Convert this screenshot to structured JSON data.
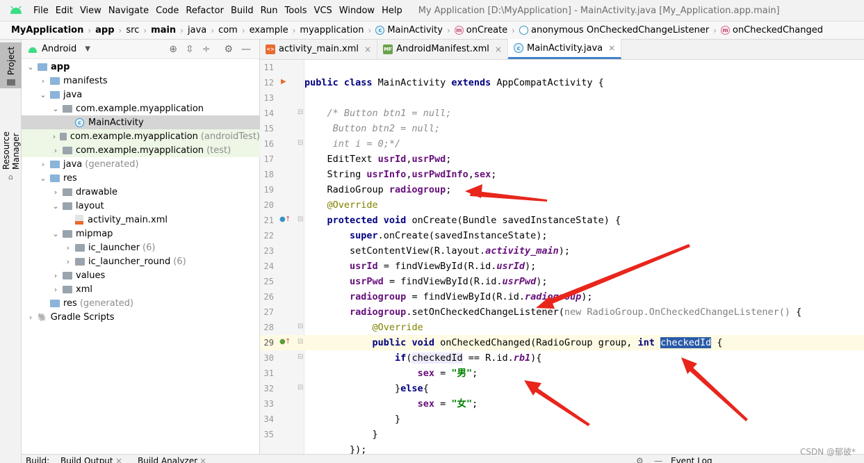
{
  "menubar": {
    "items": [
      "File",
      "Edit",
      "View",
      "Navigate",
      "Code",
      "Refactor",
      "Build",
      "Run",
      "Tools",
      "VCS",
      "Window",
      "Help"
    ],
    "window_title": "My Application [D:\\MyApplication] - MainActivity.java [My_Application.app.main]"
  },
  "breadcrumb": {
    "items": [
      {
        "label": "MyApplication",
        "bold": true,
        "icon": ""
      },
      {
        "label": "app",
        "bold": true,
        "icon": ""
      },
      {
        "label": "src",
        "bold": false,
        "icon": ""
      },
      {
        "label": "main",
        "bold": true,
        "icon": ""
      },
      {
        "label": "java",
        "bold": false,
        "icon": ""
      },
      {
        "label": "com",
        "bold": false,
        "icon": ""
      },
      {
        "label": "example",
        "bold": false,
        "icon": ""
      },
      {
        "label": "myapplication",
        "bold": false,
        "icon": ""
      },
      {
        "label": "MainActivity",
        "bold": false,
        "icon": "class-icon"
      },
      {
        "label": "onCreate",
        "bold": false,
        "icon": "method-icon"
      },
      {
        "label": "anonymous OnCheckedChangeListener",
        "bold": false,
        "icon": "anonymous-class-icon"
      },
      {
        "label": "onCheckedChanged",
        "bold": false,
        "icon": "method-icon"
      }
    ]
  },
  "left_stripe": {
    "project_label": "Project",
    "resource_label": "Resource Manager"
  },
  "project_panel": {
    "view_mode": "Android",
    "tree": [
      {
        "label": "app",
        "depth": 0,
        "expanded": true,
        "icon": "folder-icon",
        "bold": true,
        "suffix": "",
        "selected": false,
        "test": false
      },
      {
        "label": "manifests",
        "depth": 1,
        "expanded": false,
        "icon": "folder-icon",
        "bold": false,
        "suffix": "",
        "selected": false,
        "test": false
      },
      {
        "label": "java",
        "depth": 1,
        "expanded": true,
        "icon": "folder-icon",
        "bold": false,
        "suffix": "",
        "selected": false,
        "test": false
      },
      {
        "label": "com.example.myapplication",
        "depth": 2,
        "expanded": true,
        "icon": "package-icon",
        "bold": false,
        "suffix": "",
        "selected": false,
        "test": false
      },
      {
        "label": "MainActivity",
        "depth": 3,
        "expanded": null,
        "icon": "class-icon",
        "bold": false,
        "suffix": "",
        "selected": true,
        "test": false
      },
      {
        "label": "com.example.myapplication",
        "depth": 2,
        "expanded": false,
        "icon": "package-icon",
        "bold": false,
        "suffix": "(androidTest)",
        "selected": false,
        "test": true
      },
      {
        "label": "com.example.myapplication",
        "depth": 2,
        "expanded": false,
        "icon": "package-icon",
        "bold": false,
        "suffix": "(test)",
        "selected": false,
        "test": true
      },
      {
        "label": "java",
        "depth": 1,
        "expanded": false,
        "icon": "folder-icon",
        "bold": false,
        "suffix": "(generated)",
        "selected": false,
        "test": false
      },
      {
        "label": "res",
        "depth": 1,
        "expanded": true,
        "icon": "folder-icon",
        "bold": false,
        "suffix": "",
        "selected": false,
        "test": false
      },
      {
        "label": "drawable",
        "depth": 2,
        "expanded": false,
        "icon": "package-icon",
        "bold": false,
        "suffix": "",
        "selected": false,
        "test": false
      },
      {
        "label": "layout",
        "depth": 2,
        "expanded": true,
        "icon": "package-icon",
        "bold": false,
        "suffix": "",
        "selected": false,
        "test": false
      },
      {
        "label": "activity_main.xml",
        "depth": 3,
        "expanded": null,
        "icon": "xml-file-icon",
        "bold": false,
        "suffix": "",
        "selected": false,
        "test": false
      },
      {
        "label": "mipmap",
        "depth": 2,
        "expanded": true,
        "icon": "package-icon",
        "bold": false,
        "suffix": "",
        "selected": false,
        "test": false
      },
      {
        "label": "ic_launcher",
        "depth": 3,
        "expanded": false,
        "icon": "package-icon",
        "bold": false,
        "suffix": "(6)",
        "selected": false,
        "test": false
      },
      {
        "label": "ic_launcher_round",
        "depth": 3,
        "expanded": false,
        "icon": "package-icon",
        "bold": false,
        "suffix": "(6)",
        "selected": false,
        "test": false
      },
      {
        "label": "values",
        "depth": 2,
        "expanded": false,
        "icon": "package-icon",
        "bold": false,
        "suffix": "",
        "selected": false,
        "test": false
      },
      {
        "label": "xml",
        "depth": 2,
        "expanded": false,
        "icon": "package-icon",
        "bold": false,
        "suffix": "",
        "selected": false,
        "test": false
      },
      {
        "label": "res",
        "depth": 1,
        "expanded": null,
        "icon": "folder-icon",
        "bold": false,
        "suffix": "(generated)",
        "selected": false,
        "test": false
      },
      {
        "label": "Gradle Scripts",
        "depth": 0,
        "expanded": false,
        "icon": "gradle-icon",
        "bold": false,
        "suffix": "",
        "selected": false,
        "test": false
      }
    ]
  },
  "editor": {
    "tabs": [
      {
        "label": "activity_main.xml",
        "icon": "xml-file-icon",
        "active": false
      },
      {
        "label": "AndroidManifest.xml",
        "icon": "manifest-file-icon",
        "active": false
      },
      {
        "label": "MainActivity.java",
        "icon": "class-icon",
        "active": true
      }
    ],
    "current_line": 29,
    "lines": [
      {
        "n": "11",
        "tokens": []
      },
      {
        "n": "12",
        "tokens": [
          [
            "kw",
            "public class "
          ],
          [
            "",
            "MainActivity "
          ],
          [
            "kw",
            "extends "
          ],
          [
            "",
            "AppCompatActivity {"
          ]
        ]
      },
      {
        "n": "13",
        "tokens": []
      },
      {
        "n": "14",
        "tokens": [
          [
            "",
            "    "
          ],
          [
            "cmt",
            "/* Button btn1 = null;"
          ]
        ]
      },
      {
        "n": "15",
        "tokens": [
          [
            "",
            "    "
          ],
          [
            "cmt",
            " Button btn2 = null;"
          ]
        ]
      },
      {
        "n": "16",
        "tokens": [
          [
            "",
            "    "
          ],
          [
            "cmt",
            " int i = 0;*/"
          ]
        ]
      },
      {
        "n": "17",
        "tokens": [
          [
            "",
            "    EditText "
          ],
          [
            "fld",
            "usrId"
          ],
          [
            "",
            ","
          ],
          [
            "fld",
            "usrPwd"
          ],
          [
            "",
            ";"
          ]
        ]
      },
      {
        "n": "18",
        "tokens": [
          [
            "",
            "    String "
          ],
          [
            "fld",
            "usrInfo"
          ],
          [
            "",
            ","
          ],
          [
            "fld",
            "usrPwdInfo"
          ],
          [
            "",
            ","
          ],
          [
            "fld",
            "sex"
          ],
          [
            "",
            ";"
          ]
        ]
      },
      {
        "n": "19",
        "tokens": [
          [
            "",
            "    RadioGroup "
          ],
          [
            "fld",
            "radiogroup"
          ],
          [
            "",
            ";"
          ]
        ]
      },
      {
        "n": "20",
        "tokens": [
          [
            "",
            "    "
          ],
          [
            "ann",
            "@Override"
          ]
        ]
      },
      {
        "n": "21",
        "tokens": [
          [
            "",
            "    "
          ],
          [
            "kw",
            "protected void "
          ],
          [
            "",
            "onCreate(Bundle savedInstanceState) {"
          ]
        ]
      },
      {
        "n": "22",
        "tokens": [
          [
            "",
            "        "
          ],
          [
            "kw",
            "super"
          ],
          [
            "",
            ".onCreate(savedInstanceState);"
          ]
        ]
      },
      {
        "n": "23",
        "tokens": [
          [
            "",
            "        setContentView(R.layout."
          ],
          [
            "fldi",
            "activity_main"
          ],
          [
            "",
            ");"
          ]
        ]
      },
      {
        "n": "24",
        "tokens": [
          [
            "",
            "        "
          ],
          [
            "fld",
            "usrId "
          ],
          [
            "",
            "= findViewById(R.id."
          ],
          [
            "fldi",
            "usrId"
          ],
          [
            "",
            ");"
          ]
        ]
      },
      {
        "n": "25",
        "tokens": [
          [
            "",
            "        "
          ],
          [
            "fld",
            "usrPwd "
          ],
          [
            "",
            "= findViewById(R.id."
          ],
          [
            "fldi",
            "usrPwd"
          ],
          [
            "",
            ");"
          ]
        ]
      },
      {
        "n": "26",
        "tokens": [
          [
            "",
            "        "
          ],
          [
            "fld",
            "radiogroup "
          ],
          [
            "",
            "= findViewById(R.id."
          ],
          [
            "fldi",
            "radiogroup"
          ],
          [
            "",
            ");"
          ]
        ]
      },
      {
        "n": "27",
        "tokens": [
          [
            "",
            "        "
          ],
          [
            "fld",
            "radiogroup"
          ],
          [
            "",
            ".setOnCheckedChangeListener("
          ],
          [
            "gry",
            "new RadioGroup.OnCheckedChangeListener() "
          ],
          [
            "",
            "{"
          ]
        ]
      },
      {
        "n": "28",
        "tokens": [
          [
            "",
            "            "
          ],
          [
            "ann",
            "@Override"
          ]
        ]
      },
      {
        "n": "29",
        "tokens": [
          [
            "",
            "            "
          ],
          [
            "kw",
            "public void "
          ],
          [
            "",
            "onCheckedChanged(RadioGroup group, "
          ],
          [
            "kw",
            "int "
          ],
          [
            "sel",
            "checkedId"
          ],
          [
            "",
            " {"
          ]
        ]
      },
      {
        "n": "30",
        "tokens": [
          [
            "",
            "                "
          ],
          [
            "kw",
            "if"
          ],
          [
            "",
            "("
          ],
          [
            "hl",
            "checkedId"
          ],
          [
            "",
            " == R.id."
          ],
          [
            "fldi",
            "rb1"
          ],
          [
            "",
            "){"
          ]
        ]
      },
      {
        "n": "31",
        "tokens": [
          [
            "",
            "                    "
          ],
          [
            "fld",
            "sex "
          ],
          [
            "",
            "= "
          ],
          [
            "str",
            "\"男\""
          ],
          [
            "",
            ";"
          ]
        ]
      },
      {
        "n": "32",
        "tokens": [
          [
            "",
            "                }"
          ],
          [
            "kw",
            "else"
          ],
          [
            "",
            "{"
          ]
        ]
      },
      {
        "n": "33",
        "tokens": [
          [
            "",
            "                    "
          ],
          [
            "fld",
            "sex "
          ],
          [
            "",
            "= "
          ],
          [
            "str",
            "\"女\""
          ],
          [
            "",
            ";"
          ]
        ]
      },
      {
        "n": "34",
        "tokens": [
          [
            "",
            "                }"
          ]
        ]
      },
      {
        "n": "35",
        "tokens": [
          [
            "",
            "            }"
          ]
        ]
      },
      {
        "n": "",
        "tokens": [
          [
            "",
            "        });"
          ]
        ]
      }
    ]
  },
  "bottom_bar": {
    "build_label": "Build:",
    "build_output_tab": "Build Output",
    "build_analyzer_tab": "Build Analyzer",
    "event_log_label": "Event Log"
  },
  "watermark": "CSDN @郁彼*",
  "colors": {
    "accent": "#4083c9",
    "annotation_arrow": "#e8261c",
    "keyword": "#000080",
    "field": "#660e7a",
    "string": "#008000",
    "selection": "#2a5ba8",
    "current_line": "#fffae3"
  }
}
